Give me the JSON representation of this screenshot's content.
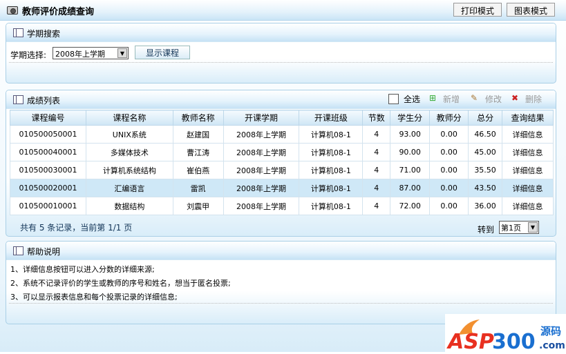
{
  "header": {
    "title": "教师评价成绩查询",
    "print_mode": "打印模式",
    "chart_mode": "图表模式"
  },
  "search": {
    "title": "学期搜索",
    "label": "学期选择:",
    "semester": "2008年上学期",
    "show_button": "显示课程"
  },
  "list": {
    "title": "成绩列表",
    "select_all": "全选",
    "add": "新增",
    "edit": "修改",
    "delete": "删除",
    "columns": [
      "课程编号",
      "课程名称",
      "教师名称",
      "开课学期",
      "开课班级",
      "节数",
      "学生分",
      "教师分",
      "总分",
      "查询结果"
    ],
    "rows": [
      [
        "010500050001",
        "UNIX系统",
        "赵建国",
        "2008年上学期",
        "计算机08-1",
        "4",
        "93.00",
        "0.00",
        "46.50",
        "详细信息"
      ],
      [
        "010500040001",
        "多媒体技术",
        "曹江涛",
        "2008年上学期",
        "计算机08-1",
        "4",
        "90.00",
        "0.00",
        "45.00",
        "详细信息"
      ],
      [
        "010500030001",
        "计算机系统结构",
        "崔伯燕",
        "2008年上学期",
        "计算机08-1",
        "4",
        "71.00",
        "0.00",
        "35.50",
        "详细信息"
      ],
      [
        "010500020001",
        "汇编语言",
        "雷凯",
        "2008年上学期",
        "计算机08-1",
        "4",
        "87.00",
        "0.00",
        "43.50",
        "详细信息"
      ],
      [
        "010500010001",
        "数据结构",
        "刘震甲",
        "2008年上学期",
        "计算机08-1",
        "4",
        "72.00",
        "0.00",
        "36.00",
        "详细信息"
      ]
    ],
    "highlighted_row": 3,
    "summary": "共有 5 条记录，当前第 1/1 页",
    "goto_label": "转到",
    "page": "第1页"
  },
  "help": {
    "title": "帮助说明",
    "lines": [
      "1、详细信息按钮可以进入分数的详细来源;",
      "2、系统不记录评价的学生或教师的序号和姓名，想当于匿名投票;",
      "3、可以显示报表信息和每个投票记录的详细信息;"
    ]
  },
  "watermark": {
    "text": "ASP300",
    "sub": "源码",
    "domain": ".com"
  }
}
